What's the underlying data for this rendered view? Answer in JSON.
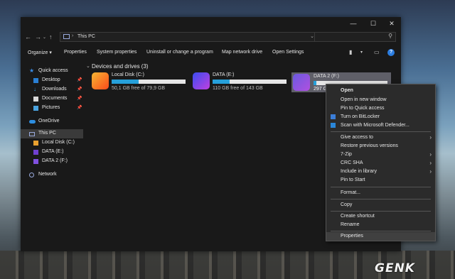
{
  "window": {
    "address": "This PC",
    "search_placeholder": ""
  },
  "toolbar": {
    "organize": "Organize ▾",
    "properties": "Properties",
    "system_properties": "System properties",
    "uninstall": "Uninstall or change a program",
    "map_drive": "Map network drive",
    "open_settings": "Open Settings"
  },
  "sidebar": {
    "quick_access": "Quick access",
    "desktop": "Desktop",
    "downloads": "Downloads",
    "documents": "Documents",
    "pictures": "Pictures",
    "onedrive": "OneDrive",
    "this_pc": "This PC",
    "local_disk": "Local Disk (C:)",
    "data_e": "DATA (E:)",
    "data2_f": "DATA 2 (F:)",
    "network": "Network"
  },
  "main": {
    "group_title": "Devices and drives (3)",
    "drives": [
      {
        "name": "Local Disk (C:)",
        "free": "50,1 GB free of 79,9 GB",
        "used_fraction": 0.37
      },
      {
        "name": "DATA (E:)",
        "free": "110 GB free of 143 GB",
        "used_fraction": 0.23
      },
      {
        "name": "DATA 2 (F:)",
        "free": "297 G",
        "used_fraction": 0.04
      }
    ]
  },
  "context_menu": {
    "open": "Open",
    "open_new_window": "Open in new window",
    "pin_quick": "Pin to Quick access",
    "bitlocker": "Turn on BitLocker",
    "defender": "Scan with Microsoft Defender...",
    "give_access": "Give access to",
    "restore": "Restore previous versions",
    "zip": "7-Zip",
    "crc": "CRC SHA",
    "library": "Include in library",
    "pin_start": "Pin to Start",
    "format": "Format...",
    "copy": "Copy",
    "shortcut": "Create shortcut",
    "rename": "Rename",
    "properties": "Properties"
  },
  "watermark": "GENK"
}
